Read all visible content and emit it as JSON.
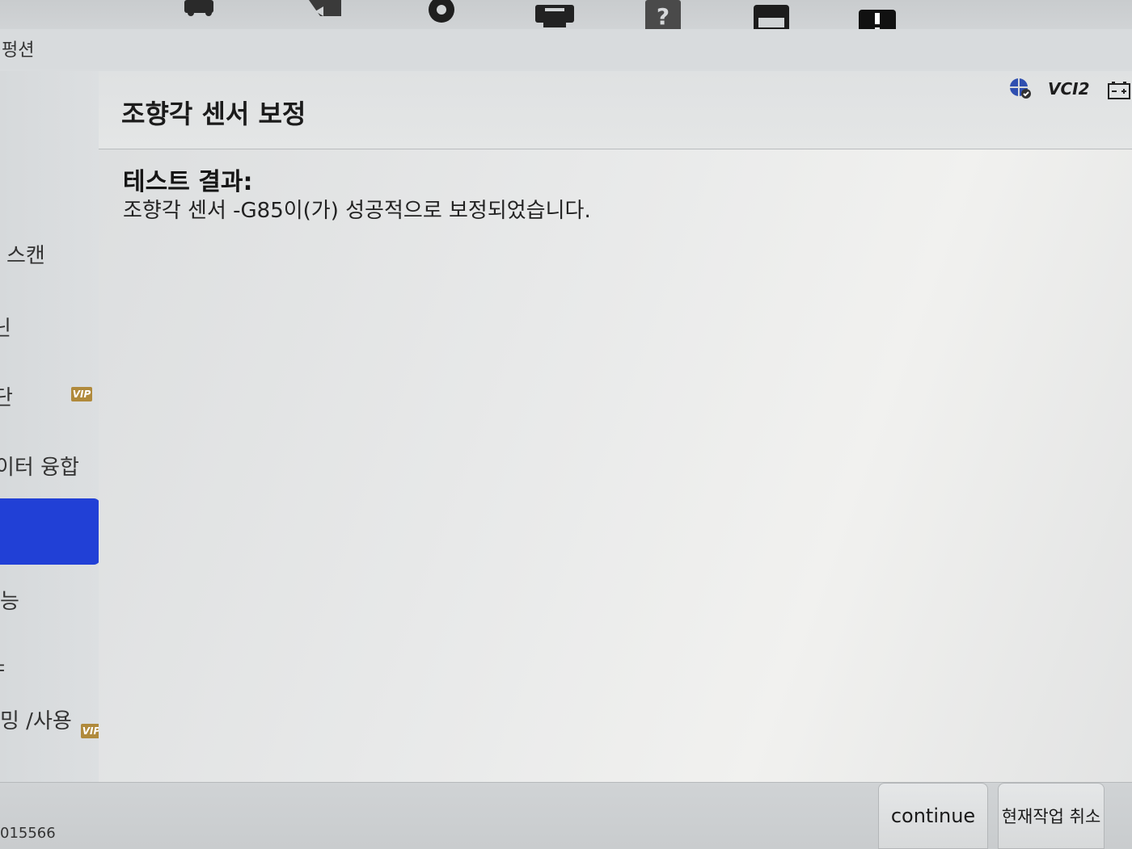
{
  "toolbar": {
    "icons": [
      "car-icon",
      "back-icon",
      "settings-icon",
      "print-icon",
      "help-icon",
      "save-icon",
      "alert-icon"
    ]
  },
  "titlebar": {
    "text": "펑션"
  },
  "sidebar": {
    "items": [
      {
        "label": "스캔"
      },
      {
        "label": "닌"
      },
      {
        "label": "단",
        "badge": "VIP"
      },
      {
        "label": "이터 융합"
      },
      {
        "label": ""
      },
      {
        "label": "능"
      },
      {
        "label": "ㅑ"
      },
      {
        "label": "밍 /사용",
        "badge": "VIP"
      }
    ]
  },
  "main": {
    "title": "조향각 센서 보정",
    "result_label": "테스트 결과:",
    "result_message": "조향각 센서 -G85이(가) 성공적으로 보정되었습니다.",
    "status": {
      "vci_label": "VCI2"
    }
  },
  "bottom": {
    "serial": "015566",
    "continue_label": "continue",
    "cancel_label": "현재작업 취소"
  },
  "colors": {
    "accent": "#2140d6",
    "vip": "#b08a3c"
  }
}
